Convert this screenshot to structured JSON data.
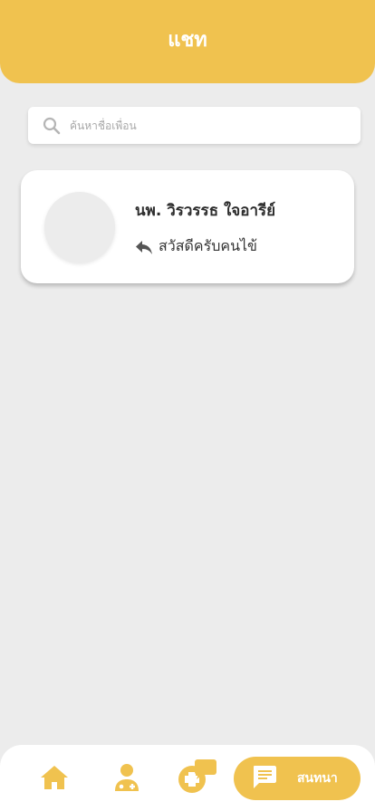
{
  "header": {
    "title": "แชท"
  },
  "search": {
    "placeholder": "ค้นหาชื่อเพื่อน",
    "value": ""
  },
  "chats": [
    {
      "name": "นพ. วิรวรรธ ใจอารีย์",
      "last_message": "สวัสดีครับคนไข้"
    }
  ],
  "bottom_nav": {
    "items": [
      {
        "icon": "home-icon"
      },
      {
        "icon": "doctor-icon"
      },
      {
        "icon": "consult-icon"
      },
      {
        "icon": "chat-icon",
        "label": "สนทนา",
        "active": true
      }
    ]
  },
  "colors": {
    "accent": "#f0c24f",
    "background": "#ececec"
  }
}
